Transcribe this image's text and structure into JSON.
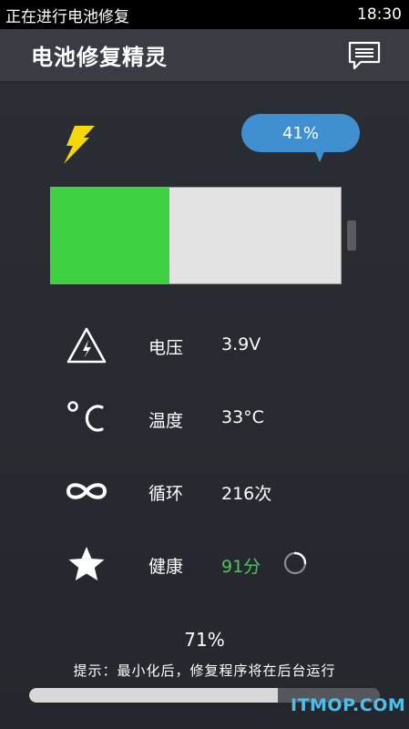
{
  "status_bar": {
    "notification": "正在进行电池修复",
    "time": "18:30"
  },
  "app_bar": {
    "title": "电池修复精灵",
    "menu_icon": "message-icon"
  },
  "battery": {
    "level_percent": 41,
    "level_label": "41%",
    "fill_color": "#3dd142"
  },
  "stats": [
    {
      "icon": "voltage-warning-icon",
      "label": "电压",
      "value": "3.9V"
    },
    {
      "icon": "celsius-icon",
      "label": "温度",
      "value": "33°C"
    },
    {
      "icon": "infinity-icon",
      "label": "循环",
      "value": "216次"
    },
    {
      "icon": "star-icon",
      "label": "健康",
      "value": "91分",
      "value_color": "#4fc65a"
    }
  ],
  "repair": {
    "progress_percent": 71,
    "progress_label": "71%",
    "hint": "提示：最小化后，修复程序将在后台运行"
  },
  "watermark": "ITMOP.COM",
  "colors": {
    "accent_blue": "#3f8fd1",
    "battery_green": "#3dd142",
    "health_green": "#4fc65a",
    "bolt_yellow": "#f5d80a"
  }
}
